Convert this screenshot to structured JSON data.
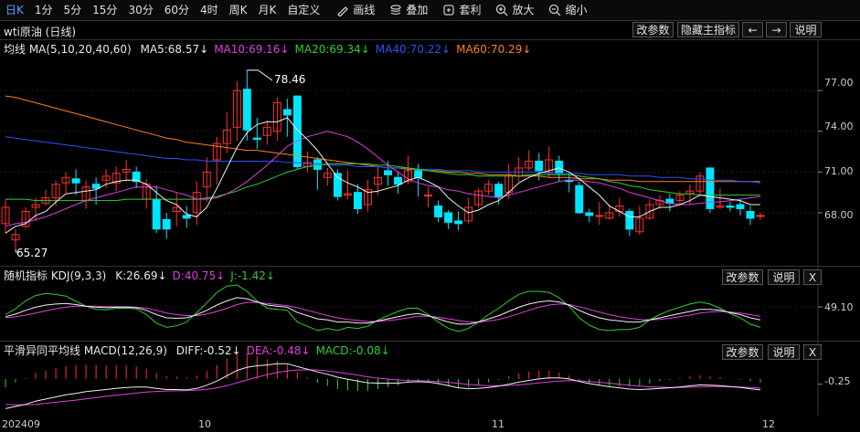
{
  "toolbar": {
    "periods": [
      "日K",
      "1分",
      "5分",
      "15分",
      "30分",
      "60分",
      "4时",
      "周K",
      "月K",
      "自定义"
    ],
    "active_index": 0,
    "tools": [
      {
        "icon": "pencil-icon",
        "label": "画线"
      },
      {
        "icon": "stack-icon",
        "label": "叠加"
      },
      {
        "icon": "arbitrage-icon",
        "label": "套利"
      },
      {
        "icon": "zoom-in-icon",
        "label": "放大"
      },
      {
        "icon": "zoom-out-icon",
        "label": "缩小"
      }
    ]
  },
  "title": "wti原油 (日线)",
  "buttons": {
    "params": "改参数",
    "hide": "隐藏主指标",
    "prev": "←",
    "next": "→",
    "explain": "说明",
    "close": "X"
  },
  "ma_legend": {
    "label": "均线 MA(5,10,20,40,60)",
    "items": [
      {
        "text": "MA5:68.57↓",
        "color": "#e8e8e8"
      },
      {
        "text": "MA10:69.16↓",
        "color": "#e040e0"
      },
      {
        "text": "MA20:69.34↓",
        "color": "#30d030"
      },
      {
        "text": "MA40:70.22↓",
        "color": "#3050ff"
      },
      {
        "text": "MA60:70.29↓",
        "color": "#ff8020"
      }
    ]
  },
  "kdj_legend": {
    "label": "随机指标 KDJ(9,3,3)",
    "items": [
      {
        "text": "K:26.69↓",
        "color": "#e8e8e8"
      },
      {
        "text": "D:40.75↓",
        "color": "#e040e0"
      },
      {
        "text": "J:-1.42↓",
        "color": "#30d030"
      }
    ]
  },
  "macd_legend": {
    "label": "平滑异同平均线 MACD(12,26,9)",
    "items": [
      {
        "text": "DIFF:-0.52↓",
        "color": "#e8e8e8"
      },
      {
        "text": "DEA:-0.48↓",
        "color": "#e040e0"
      },
      {
        "text": "MACD:-0.08↓",
        "color": "#30d030"
      }
    ]
  },
  "annotations": {
    "high": "78.46",
    "low": "65.27"
  },
  "price_axis": [
    "77.00",
    "74.00",
    "71.00",
    "68.00"
  ],
  "kdj_axis": [
    "49.10"
  ],
  "macd_axis": [
    "-0.25"
  ],
  "x_axis": [
    "202409",
    "10",
    "11",
    "12"
  ],
  "colors": {
    "up": "#ff3030",
    "down": "#00e5ff",
    "bg": "#000000"
  },
  "chart_data": {
    "type": "candlestick",
    "price_range": [
      64.5,
      79.5
    ],
    "candles": [
      [
        67.2,
        68.4,
        69.0,
        66.5
      ],
      [
        66.0,
        66.4,
        66.8,
        65.3
      ],
      [
        67.0,
        68.1,
        68.4,
        66.9
      ],
      [
        68.4,
        68.6,
        69.1,
        67.4
      ],
      [
        68.7,
        69.1,
        69.7,
        68.5
      ],
      [
        69.1,
        70.1,
        70.4,
        68.5
      ],
      [
        70.2,
        70.6,
        71.0,
        69.4
      ],
      [
        70.5,
        70.2,
        71.2,
        69.3
      ],
      [
        68.9,
        69.9,
        70.4,
        68.3
      ],
      [
        70.1,
        69.8,
        70.6,
        68.6
      ],
      [
        70.4,
        70.7,
        71.2,
        69.8
      ],
      [
        70.2,
        70.9,
        71.4,
        69.6
      ],
      [
        71.0,
        71.2,
        71.9,
        70.3
      ],
      [
        71.0,
        70.3,
        71.4,
        69.8
      ],
      [
        69.0,
        70.1,
        70.5,
        68.3
      ],
      [
        69.0,
        66.8,
        70.0,
        66.5
      ],
      [
        67.5,
        66.8,
        68.0,
        66.1
      ],
      [
        68.1,
        68.4,
        69.5,
        67.0
      ],
      [
        67.8,
        67.6,
        68.5,
        66.9
      ],
      [
        68.0,
        69.5,
        70.3,
        67.1
      ],
      [
        69.9,
        71.0,
        72.1,
        68.8
      ],
      [
        71.9,
        73.1,
        73.6,
        70.1
      ],
      [
        73.1,
        74.1,
        75.4,
        72.4
      ],
      [
        74.3,
        77.0,
        77.7,
        73.3
      ],
      [
        77.1,
        74.1,
        78.5,
        73.3
      ],
      [
        73.5,
        73.4,
        75.0,
        72.7
      ],
      [
        73.7,
        74.3,
        74.8,
        73.0
      ],
      [
        74.0,
        76.1,
        76.5,
        73.3
      ],
      [
        75.6,
        75.2,
        76.4,
        73.6
      ],
      [
        76.6,
        71.4,
        76.6,
        71.2
      ],
      [
        71.4,
        71.7,
        72.5,
        71.0
      ],
      [
        71.9,
        71.2,
        72.1,
        69.7
      ],
      [
        70.6,
        70.9,
        71.3,
        70.0
      ],
      [
        70.9,
        69.2,
        71.2,
        68.9
      ],
      [
        69.3,
        69.4,
        71.1,
        69.0
      ],
      [
        69.5,
        68.3,
        70.1,
        67.9
      ],
      [
        68.6,
        69.7,
        70.4,
        68.1
      ],
      [
        70.1,
        70.6,
        71.4,
        69.3
      ],
      [
        71.1,
        70.8,
        71.8,
        70.0
      ],
      [
        70.6,
        70.1,
        71.0,
        69.4
      ],
      [
        70.3,
        71.1,
        72.2,
        70.1
      ],
      [
        71.1,
        70.6,
        71.6,
        69.2
      ],
      [
        69.3,
        69.3,
        69.9,
        68.4
      ],
      [
        68.5,
        67.7,
        68.9,
        67.3
      ],
      [
        68.0,
        67.3,
        68.2,
        66.8
      ],
      [
        67.4,
        67.2,
        68.1,
        66.7
      ],
      [
        67.4,
        68.4,
        69.1,
        67.2
      ],
      [
        68.6,
        69.6,
        69.8,
        68.4
      ],
      [
        69.6,
        70.1,
        70.4,
        69.3
      ],
      [
        70.1,
        69.2,
        70.3,
        68.6
      ],
      [
        69.5,
        70.7,
        71.6,
        69.0
      ],
      [
        70.7,
        71.3,
        72.1,
        70.3
      ],
      [
        71.3,
        71.8,
        72.6,
        71.1
      ],
      [
        71.8,
        71.1,
        72.4,
        70.4
      ],
      [
        71.0,
        71.9,
        72.9,
        70.6
      ],
      [
        71.8,
        70.9,
        72.2,
        70.3
      ],
      [
        70.4,
        70.3,
        70.9,
        69.5
      ],
      [
        70.0,
        68.0,
        70.3,
        67.9
      ],
      [
        68.0,
        67.8,
        68.3,
        67.3
      ],
      [
        67.8,
        67.8,
        68.8,
        67.1
      ],
      [
        67.6,
        68.0,
        68.6,
        67.5
      ],
      [
        68.1,
        68.5,
        69.1,
        67.7
      ],
      [
        68.1,
        66.8,
        68.3,
        66.3
      ],
      [
        66.6,
        67.6,
        68.5,
        66.4
      ],
      [
        67.6,
        68.6,
        69.0,
        67.5
      ],
      [
        68.6,
        68.9,
        69.3,
        68.3
      ],
      [
        69.0,
        68.7,
        69.4,
        68.1
      ],
      [
        68.9,
        69.3,
        69.6,
        68.6
      ],
      [
        69.4,
        69.6,
        70.1,
        68.6
      ],
      [
        69.6,
        70.7,
        71.0,
        69.3
      ],
      [
        71.3,
        68.3,
        71.3,
        68.0
      ],
      [
        68.4,
        68.5,
        69.8,
        68.3
      ],
      [
        68.5,
        68.4,
        68.8,
        68.1
      ],
      [
        68.6,
        68.3,
        69.0,
        67.8
      ],
      [
        68.1,
        67.6,
        68.5,
        67.1
      ],
      [
        67.8,
        67.8,
        68.0,
        67.5
      ]
    ],
    "ma5": [
      66.5,
      67.0,
      67.2,
      67.8,
      68.1,
      68.8,
      69.4,
      69.5,
      69.6,
      69.7,
      70.1,
      70.3,
      70.4,
      70.4,
      70.1,
      69.5,
      68.9,
      68.6,
      67.9,
      67.7,
      68.4,
      69.8,
      71.3,
      72.8,
      73.9,
      74.5,
      74.7,
      74.7,
      75.0,
      74.1,
      73.4,
      72.6,
      71.6,
      70.6,
      70.2,
      69.9,
      69.5,
      69.6,
      69.8,
      70.0,
      70.4,
      70.6,
      70.3,
      69.9,
      69.1,
      68.5,
      68.0,
      68.2,
      68.6,
      68.9,
      69.5,
      70.2,
      70.6,
      70.9,
      71.1,
      71.3,
      71.0,
      70.5,
      69.9,
      69.3,
      68.5,
      68.1,
      67.7,
      67.7,
      68.1,
      68.4,
      68.4,
      68.6,
      68.9,
      69.3,
      69.2,
      69.1,
      69.0,
      68.9,
      68.6,
      68.6
    ],
    "ma10": [
      67.0,
      67.2,
      67.3,
      67.5,
      67.7,
      68.0,
      68.3,
      68.6,
      68.9,
      69.1,
      69.3,
      69.5,
      69.7,
      69.9,
      69.9,
      69.9,
      69.7,
      69.5,
      69.3,
      69.0,
      69.0,
      69.1,
      69.4,
      69.8,
      70.3,
      70.9,
      71.5,
      72.2,
      72.9,
      73.3,
      73.6,
      73.8,
      74.0,
      73.8,
      73.6,
      73.2,
      72.7,
      72.1,
      71.5,
      71.0,
      70.5,
      70.2,
      70.0,
      69.9,
      69.7,
      69.6,
      69.4,
      69.3,
      69.2,
      69.1,
      69.3,
      69.5,
      69.7,
      69.9,
      70.1,
      70.3,
      70.4,
      70.4,
      70.3,
      70.2,
      70.0,
      69.8,
      69.5,
      69.3,
      69.1,
      68.9,
      68.7,
      68.6,
      68.6,
      68.7,
      68.8,
      68.8,
      68.9,
      69.0,
      69.1,
      69.2
    ],
    "ma20": [
      69.0,
      69.0,
      69.0,
      68.9,
      68.9,
      68.9,
      68.9,
      68.9,
      68.9,
      68.9,
      68.9,
      68.9,
      69.0,
      69.0,
      69.0,
      69.0,
      69.0,
      69.0,
      69.0,
      69.0,
      69.1,
      69.2,
      69.4,
      69.6,
      69.9,
      70.1,
      70.4,
      70.7,
      71.0,
      71.2,
      71.4,
      71.5,
      71.6,
      71.6,
      71.6,
      71.6,
      71.6,
      71.5,
      71.5,
      71.4,
      71.3,
      71.2,
      71.1,
      71.0,
      70.9,
      70.8,
      70.8,
      70.7,
      70.7,
      70.7,
      70.7,
      70.7,
      70.8,
      70.8,
      70.8,
      70.8,
      70.8,
      70.7,
      70.6,
      70.5,
      70.3,
      70.2,
      70.0,
      69.9,
      69.7,
      69.6,
      69.5,
      69.4,
      69.4,
      69.3,
      69.3,
      69.3,
      69.3,
      69.3,
      69.3,
      69.3
    ],
    "ma40": [
      73.6,
      73.5,
      73.4,
      73.3,
      73.2,
      73.1,
      73.0,
      72.9,
      72.8,
      72.7,
      72.6,
      72.5,
      72.4,
      72.3,
      72.2,
      72.1,
      72.0,
      72.0,
      71.9,
      71.9,
      71.8,
      71.8,
      71.8,
      71.8,
      71.8,
      71.8,
      71.8,
      71.8,
      71.7,
      71.7,
      71.6,
      71.6,
      71.5,
      71.5,
      71.5,
      71.4,
      71.4,
      71.4,
      71.3,
      71.3,
      71.3,
      71.2,
      71.2,
      71.2,
      71.1,
      71.1,
      71.1,
      71.0,
      71.0,
      71.0,
      71.0,
      71.0,
      71.0,
      71.0,
      70.9,
      70.9,
      70.9,
      70.9,
      70.8,
      70.8,
      70.8,
      70.8,
      70.7,
      70.7,
      70.7,
      70.6,
      70.6,
      70.6,
      70.5,
      70.5,
      70.4,
      70.4,
      70.4,
      70.3,
      70.3,
      70.2
    ],
    "ma60": [
      76.6,
      76.5,
      76.3,
      76.1,
      75.9,
      75.7,
      75.5,
      75.3,
      75.1,
      74.9,
      74.7,
      74.5,
      74.3,
      74.1,
      73.9,
      73.7,
      73.5,
      73.4,
      73.2,
      73.1,
      73.0,
      72.9,
      72.8,
      72.7,
      72.6,
      72.6,
      72.5,
      72.4,
      72.3,
      72.2,
      72.1,
      72.0,
      71.9,
      71.8,
      71.7,
      71.6,
      71.5,
      71.4,
      71.3,
      71.3,
      71.2,
      71.2,
      71.1,
      71.1,
      71.0,
      71.0,
      70.9,
      70.9,
      70.8,
      70.8,
      70.8,
      70.7,
      70.7,
      70.7,
      70.6,
      70.6,
      70.6,
      70.5,
      70.5,
      70.5,
      70.4,
      70.4,
      70.4,
      70.3,
      70.3,
      70.3,
      70.3,
      70.3,
      70.3,
      70.3,
      70.3,
      70.3,
      70.3,
      70.3,
      70.3,
      70.3
    ],
    "kdj_range": [
      0,
      100
    ],
    "K": [
      40,
      45,
      52,
      58,
      62,
      64,
      65,
      63,
      60,
      58,
      57,
      58,
      58,
      57,
      52,
      44,
      38,
      37,
      38,
      44,
      52,
      62,
      70,
      76,
      74,
      68,
      62,
      60,
      58,
      48,
      42,
      36,
      34,
      30,
      30,
      28,
      28,
      32,
      36,
      40,
      44,
      46,
      42,
      36,
      30,
      26,
      26,
      30,
      36,
      42,
      50,
      58,
      64,
      68,
      70,
      68,
      62,
      52,
      44,
      38,
      34,
      32,
      30,
      30,
      34,
      38,
      42,
      46,
      50,
      54,
      54,
      52,
      48,
      44,
      38,
      34
    ],
    "D": [
      38,
      40,
      43,
      47,
      51,
      55,
      58,
      60,
      60,
      60,
      59,
      59,
      59,
      58,
      56,
      52,
      47,
      44,
      42,
      42,
      45,
      50,
      56,
      63,
      67,
      67,
      65,
      63,
      61,
      57,
      52,
      47,
      42,
      38,
      35,
      33,
      31,
      31,
      33,
      35,
      38,
      41,
      41,
      39,
      36,
      33,
      30,
      30,
      32,
      35,
      40,
      46,
      52,
      58,
      62,
      64,
      63,
      59,
      54,
      49,
      44,
      40,
      37,
      35,
      34,
      35,
      37,
      40,
      43,
      47,
      49,
      50,
      49,
      47,
      44,
      41
    ],
    "J": [
      44,
      55,
      70,
      80,
      84,
      82,
      79,
      69,
      60,
      54,
      53,
      56,
      56,
      55,
      44,
      28,
      20,
      23,
      30,
      48,
      66,
      86,
      98,
      100,
      88,
      70,
      56,
      54,
      52,
      30,
      22,
      14,
      18,
      14,
      20,
      18,
      22,
      34,
      42,
      50,
      56,
      56,
      44,
      30,
      18,
      12,
      18,
      30,
      44,
      56,
      70,
      82,
      88,
      88,
      86,
      76,
      60,
      38,
      24,
      16,
      14,
      16,
      16,
      20,
      34,
      44,
      52,
      58,
      64,
      68,
      64,
      56,
      46,
      38,
      26,
      20
    ],
    "DIFF": [
      -1.4,
      -1.3,
      -1.2,
      -1.05,
      -0.95,
      -0.85,
      -0.75,
      -0.68,
      -0.6,
      -0.55,
      -0.5,
      -0.45,
      -0.4,
      -0.38,
      -0.38,
      -0.45,
      -0.5,
      -0.5,
      -0.52,
      -0.45,
      -0.3,
      -0.1,
      0.15,
      0.4,
      0.55,
      0.62,
      0.66,
      0.72,
      0.72,
      0.58,
      0.46,
      0.33,
      0.22,
      0.08,
      -0.02,
      -0.1,
      -0.18,
      -0.2,
      -0.2,
      -0.2,
      -0.15,
      -0.13,
      -0.15,
      -0.22,
      -0.32,
      -0.42,
      -0.46,
      -0.45,
      -0.4,
      -0.34,
      -0.25,
      -0.15,
      -0.07,
      0.0,
      0.05,
      0.05,
      0.0,
      -0.12,
      -0.22,
      -0.3,
      -0.37,
      -0.42,
      -0.48,
      -0.5,
      -0.48,
      -0.45,
      -0.42,
      -0.38,
      -0.33,
      -0.28,
      -0.3,
      -0.32,
      -0.36,
      -0.4,
      -0.46,
      -0.52
    ],
    "DEA": [
      -1.2,
      -1.22,
      -1.22,
      -1.2,
      -1.15,
      -1.1,
      -1.05,
      -1.0,
      -0.94,
      -0.88,
      -0.82,
      -0.77,
      -0.72,
      -0.67,
      -0.62,
      -0.59,
      -0.57,
      -0.56,
      -0.55,
      -0.53,
      -0.49,
      -0.42,
      -0.32,
      -0.18,
      -0.05,
      0.08,
      0.2,
      0.3,
      0.38,
      0.42,
      0.43,
      0.42,
      0.38,
      0.32,
      0.25,
      0.18,
      0.1,
      0.04,
      -0.01,
      -0.05,
      -0.07,
      -0.08,
      -0.1,
      -0.12,
      -0.16,
      -0.21,
      -0.26,
      -0.3,
      -0.32,
      -0.32,
      -0.31,
      -0.28,
      -0.24,
      -0.19,
      -0.14,
      -0.1,
      -0.08,
      -0.09,
      -0.12,
      -0.16,
      -0.2,
      -0.25,
      -0.3,
      -0.34,
      -0.37,
      -0.39,
      -0.4,
      -0.4,
      -0.39,
      -0.37,
      -0.36,
      -0.36,
      -0.37,
      -0.38,
      -0.4,
      -0.43
    ]
  }
}
